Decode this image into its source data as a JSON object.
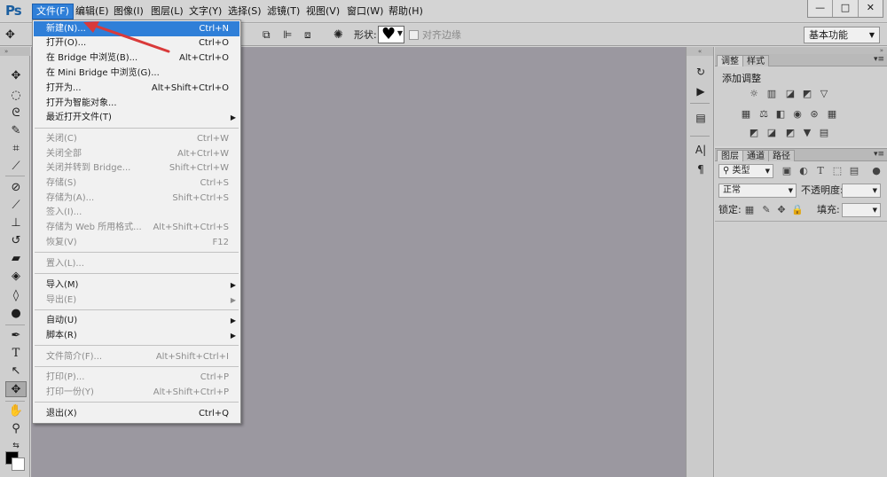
{
  "app": {
    "logo": "Ps"
  },
  "menubar": [
    {
      "label": "文件(F)",
      "active": true
    },
    {
      "label": "编辑(E)"
    },
    {
      "label": "图像(I)"
    },
    {
      "label": "图层(L)"
    },
    {
      "label": "文字(Y)"
    },
    {
      "label": "选择(S)"
    },
    {
      "label": "滤镜(T)"
    },
    {
      "label": "视图(V)"
    },
    {
      "label": "窗口(W)"
    },
    {
      "label": "帮助(H)"
    }
  ],
  "window_controls": {
    "minimize": "—",
    "restore": "□",
    "close": "✕"
  },
  "options_bar": {
    "shape_label": "形状:",
    "align_edges_label": "对齐边缘",
    "workspace": "基本功能"
  },
  "file_menu": [
    {
      "label": "新建(N)...",
      "shortcut": "Ctrl+N",
      "highlighted": true
    },
    {
      "label": "打开(O)...",
      "shortcut": "Ctrl+O"
    },
    {
      "label": "在 Bridge 中浏览(B)...",
      "shortcut": "Alt+Ctrl+O"
    },
    {
      "label": "在 Mini Bridge 中浏览(G)...",
      "shortcut": ""
    },
    {
      "label": "打开为...",
      "shortcut": "Alt+Shift+Ctrl+O"
    },
    {
      "label": "打开为智能对象...",
      "shortcut": ""
    },
    {
      "label": "最近打开文件(T)",
      "shortcut": "",
      "submenu": true
    },
    {
      "label": "关闭(C)",
      "shortcut": "Ctrl+W",
      "disabled": true
    },
    {
      "label": "关闭全部",
      "shortcut": "Alt+Ctrl+W",
      "disabled": true
    },
    {
      "label": "关闭并转到 Bridge...",
      "shortcut": "Shift+Ctrl+W",
      "disabled": true
    },
    {
      "label": "存储(S)",
      "shortcut": "Ctrl+S",
      "disabled": true
    },
    {
      "label": "存储为(A)...",
      "shortcut": "Shift+Ctrl+S",
      "disabled": true
    },
    {
      "label": "签入(I)...",
      "shortcut": "",
      "disabled": true
    },
    {
      "label": "存储为 Web 所用格式...",
      "shortcut": "Alt+Shift+Ctrl+S",
      "disabled": true
    },
    {
      "label": "恢复(V)",
      "shortcut": "F12",
      "disabled": true
    },
    {
      "label": "置入(L)...",
      "shortcut": "",
      "disabled": true
    },
    {
      "label": "导入(M)",
      "shortcut": "",
      "submenu": true
    },
    {
      "label": "导出(E)",
      "shortcut": "",
      "submenu": true,
      "disabled": true
    },
    {
      "label": "自动(U)",
      "shortcut": "",
      "submenu": true
    },
    {
      "label": "脚本(R)",
      "shortcut": "",
      "submenu": true
    },
    {
      "label": "文件简介(F)...",
      "shortcut": "Alt+Shift+Ctrl+I",
      "disabled": true
    },
    {
      "label": "打印(P)...",
      "shortcut": "Ctrl+P",
      "disabled": true
    },
    {
      "label": "打印一份(Y)",
      "shortcut": "Alt+Shift+Ctrl+P",
      "disabled": true
    },
    {
      "label": "退出(X)",
      "shortcut": "Ctrl+Q"
    }
  ],
  "adjustments_panel": {
    "tabs": [
      "调整",
      "样式"
    ],
    "title": "添加调整"
  },
  "layers_panel": {
    "tabs": [
      "图层",
      "通道",
      "路径"
    ],
    "filter_kind": "类型",
    "blend_mode": "正常",
    "opacity_label": "不透明度:",
    "lock_label": "锁定:",
    "fill_label": "填充:"
  },
  "colors": {
    "menu_highlight": "#2f7fd8",
    "canvas_bg": "#9b98a0",
    "arrow": "#d93a3a"
  }
}
